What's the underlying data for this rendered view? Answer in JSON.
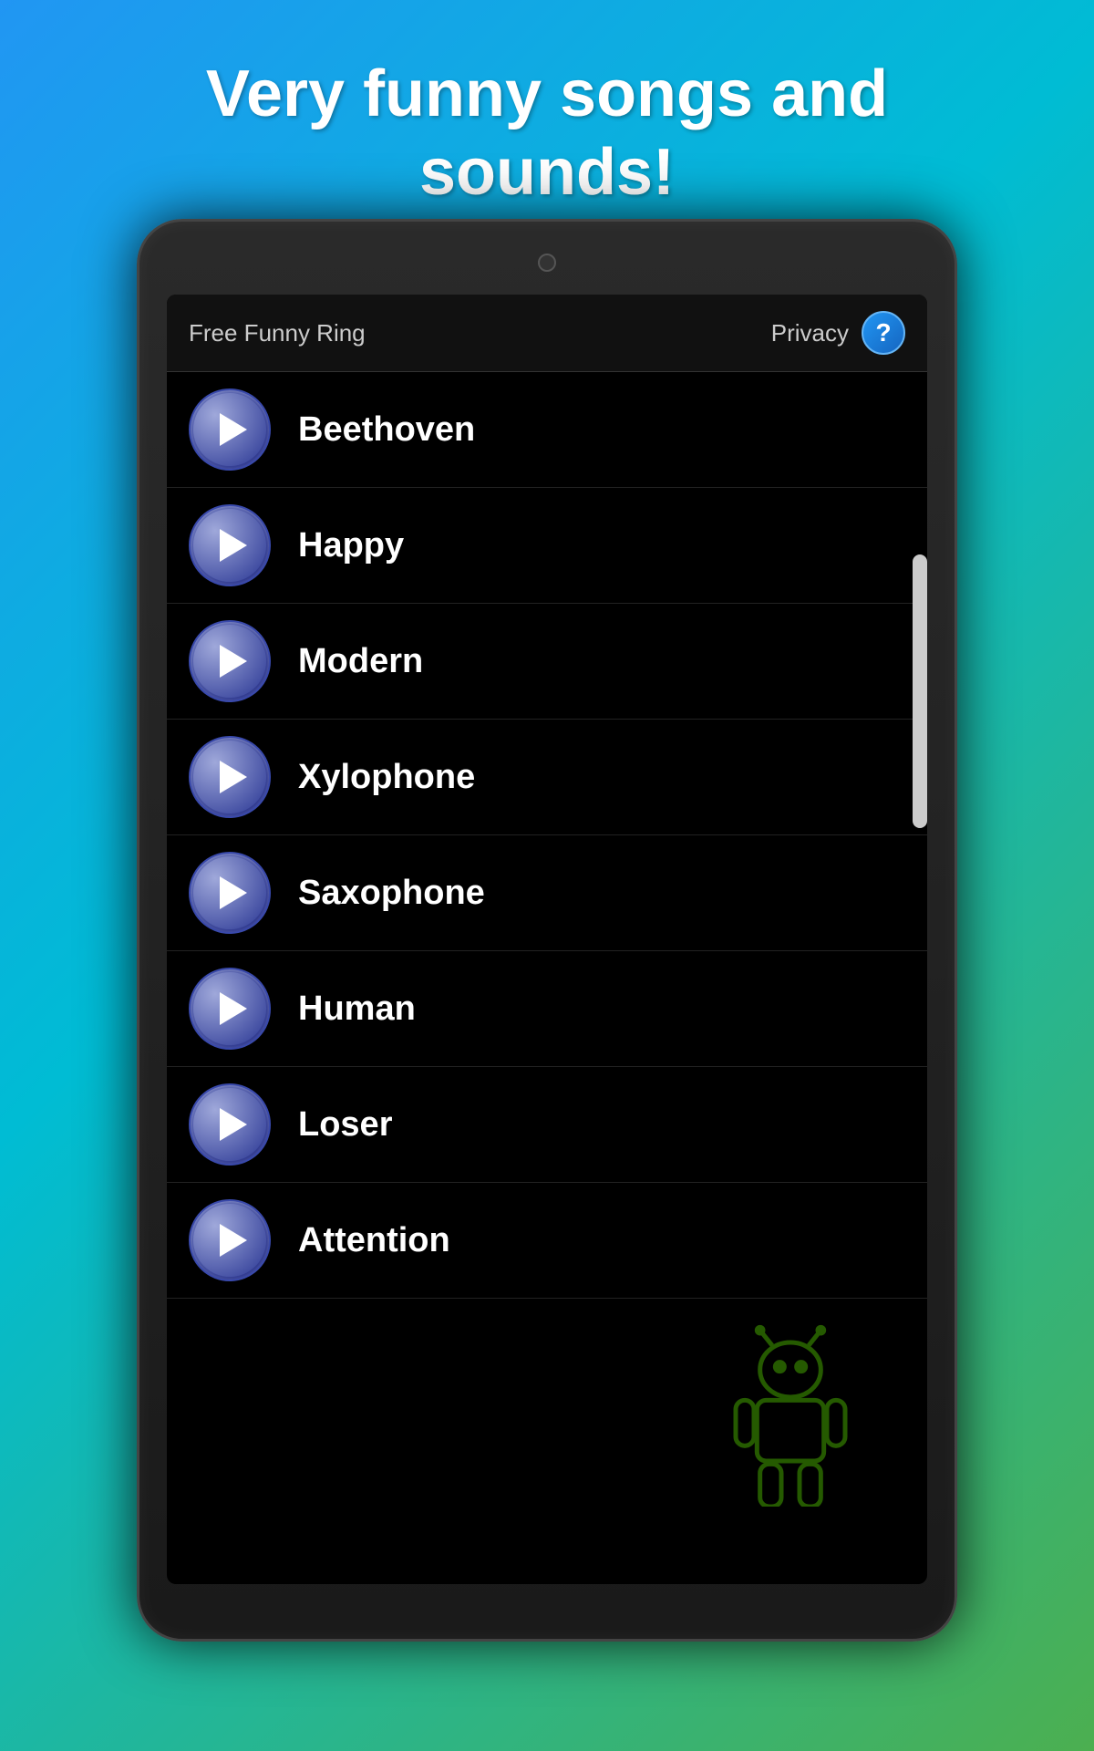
{
  "header": {
    "title": "Very funny songs and sounds!"
  },
  "app": {
    "title": "Free Funny Ring",
    "privacy_label": "Privacy",
    "help_label": "?"
  },
  "items": [
    {
      "id": 1,
      "label": "Beethoven"
    },
    {
      "id": 2,
      "label": "Happy"
    },
    {
      "id": 3,
      "label": "Modern"
    },
    {
      "id": 4,
      "label": "Xylophone"
    },
    {
      "id": 5,
      "label": "Saxophone"
    },
    {
      "id": 6,
      "label": "Human"
    },
    {
      "id": 7,
      "label": "Loser"
    },
    {
      "id": 8,
      "label": "Attention"
    }
  ]
}
